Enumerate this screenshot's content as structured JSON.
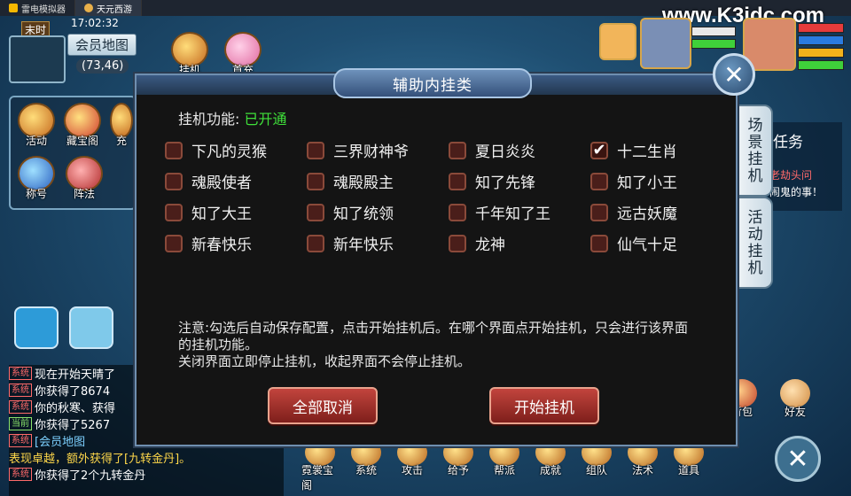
{
  "emulator": {
    "tabs": [
      {
        "label": "雷电模拟器"
      },
      {
        "label": "天元西游"
      }
    ],
    "watermark": "www.K3idc.com"
  },
  "hud": {
    "time": "17:02:32",
    "period": "末时",
    "map_name": "会员地图",
    "coords": "(73,46)",
    "top_icons": [
      {
        "label": "挂机"
      },
      {
        "label": "首充"
      }
    ],
    "side_icons": [
      {
        "label": "活动"
      },
      {
        "label": "藏宝阁"
      },
      {
        "label": "充"
      },
      {
        "label": "称号"
      },
      {
        "label": "阵法"
      }
    ]
  },
  "task": {
    "title": "任务",
    "line1": "老劫头问",
    "line2": "闹鬼的事！"
  },
  "side_tabs": [
    {
      "label": "场景挂机"
    },
    {
      "label": "活动挂机"
    }
  ],
  "dialog": {
    "title": "辅助内挂类",
    "function_label": "挂机功能:",
    "function_status": "已开通",
    "options": [
      {
        "label": "下凡的灵猴",
        "checked": false
      },
      {
        "label": "三界财神爷",
        "checked": false
      },
      {
        "label": "夏日炎炎",
        "checked": false
      },
      {
        "label": "十二生肖",
        "checked": true
      },
      {
        "label": "魂殿使者",
        "checked": false
      },
      {
        "label": "魂殿殿主",
        "checked": false
      },
      {
        "label": "知了先锋",
        "checked": false
      },
      {
        "label": "知了小王",
        "checked": false
      },
      {
        "label": "知了大王",
        "checked": false
      },
      {
        "label": "知了统领",
        "checked": false
      },
      {
        "label": "千年知了王",
        "checked": false
      },
      {
        "label": "远古妖魔",
        "checked": false
      },
      {
        "label": "新春快乐",
        "checked": false
      },
      {
        "label": "新年快乐",
        "checked": false
      },
      {
        "label": "龙神",
        "checked": false
      },
      {
        "label": "仙气十足",
        "checked": false
      }
    ],
    "note_line1": "注意:勾选后自动保存配置，点击开始挂机后。在哪个界面点开始挂机，只会进行该界面的挂机功能。",
    "note_line2": "关闭界面立即停止挂机，收起界面不会停止挂机。",
    "cancel_all_label": "全部取消",
    "start_label": "开始挂机",
    "close_glyph": "✕"
  },
  "chat": {
    "lines": [
      {
        "tag": "系统",
        "text": "现在开始天晴了"
      },
      {
        "tag": "系统",
        "text": "你获得了8674"
      },
      {
        "tag": "系统",
        "text": "你的秋寒、获得"
      },
      {
        "tag": "当前",
        "text": "你获得了5267"
      },
      {
        "tag": "系统",
        "text": "[会员地图"
      },
      {
        "tag": "",
        "text": "表现卓越，额外获得了[九转金丹]。"
      },
      {
        "tag": "系统",
        "text": "你获得了2个九转金丹"
      }
    ]
  },
  "bottom_bar": {
    "items": [
      {
        "label": "霓裳宝阁"
      },
      {
        "label": "系统"
      },
      {
        "label": "攻击"
      },
      {
        "label": "给予"
      },
      {
        "label": "帮派"
      },
      {
        "label": "成就"
      },
      {
        "label": "组队"
      },
      {
        "label": "法术"
      },
      {
        "label": "道具"
      }
    ],
    "right_items": [
      {
        "label": "背包"
      },
      {
        "label": "好友"
      }
    ],
    "close_glyph": "✕"
  }
}
